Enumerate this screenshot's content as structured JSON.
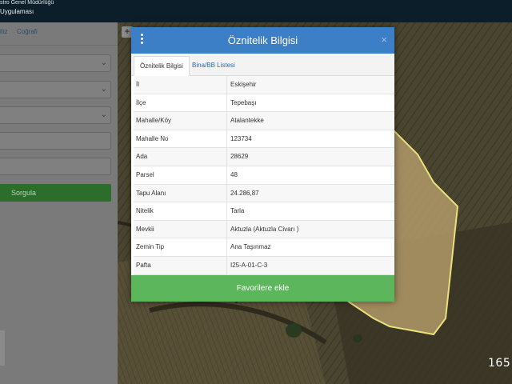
{
  "header": {
    "line1": "stro Genel Müdürlüğü",
    "line2": "Uygulaması"
  },
  "left_panel": {
    "tabs": [
      "iliz",
      "Coğrafi"
    ],
    "query_button": "Sorgula"
  },
  "map": {
    "zoom_in": "+",
    "scale_text": "165"
  },
  "modal": {
    "title": "Öznitelik Bilgisi",
    "close": "×",
    "tabs": [
      {
        "label": "Öznitelik Bilgisi",
        "active": true
      },
      {
        "label": "Bina/BB Listesi",
        "active": false
      }
    ],
    "rows": [
      {
        "key": "İl",
        "value": "Eskişehir"
      },
      {
        "key": "İlçe",
        "value": "Tepebaşı"
      },
      {
        "key": "Mahalle/Köy",
        "value": "Atalantekke"
      },
      {
        "key": "Mahalle No",
        "value": "123734"
      },
      {
        "key": "Ada",
        "value": "28629"
      },
      {
        "key": "Parsel",
        "value": "48"
      },
      {
        "key": "Tapu Alanı",
        "value": "24.286,87"
      },
      {
        "key": "Nitelik",
        "value": "Tarla"
      },
      {
        "key": "Mevkii",
        "value": "Aktuzla (Aktuzla Civarı )"
      },
      {
        "key": "Zemin Tip",
        "value": "Ana Taşınmaz"
      },
      {
        "key": "Pafta",
        "value": "I25-A-01-C-3"
      }
    ],
    "favorite_button": "Favorilere ekle"
  },
  "colors": {
    "header_bg": "#0c1e2a",
    "modal_header": "#3d7fc7",
    "favorite_button": "#5cb65c",
    "parcel_outline": "#e8e07a"
  }
}
